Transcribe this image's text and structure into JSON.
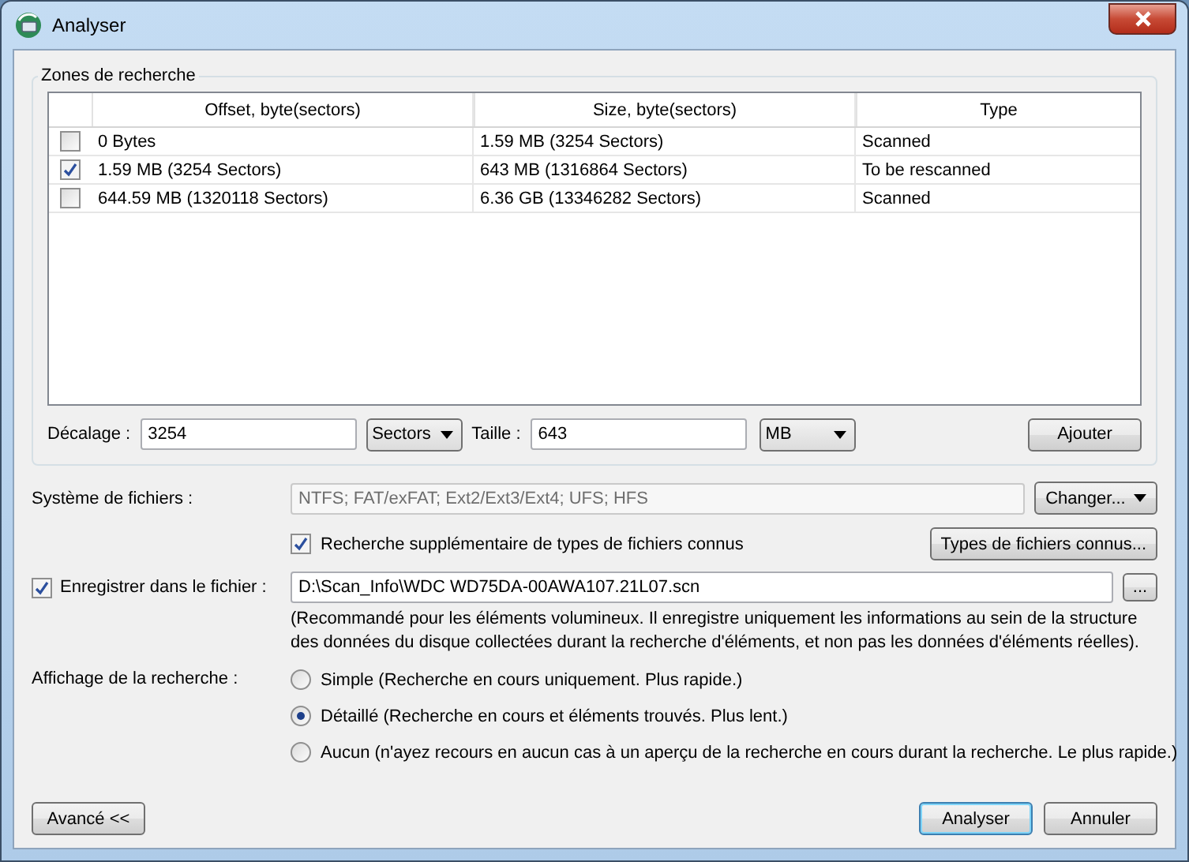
{
  "window": {
    "title": "Analyser"
  },
  "search_zones": {
    "title": "Zones de recherche",
    "columns": [
      "Offset, byte(sectors)",
      "Size, byte(sectors)",
      "Type"
    ],
    "rows": [
      {
        "checked": false,
        "offset": "0 Bytes",
        "size": "1.59 MB (3254 Sectors)",
        "type": "Scanned"
      },
      {
        "checked": true,
        "offset": "1.59 MB (3254 Sectors)",
        "size": "643 MB (1316864 Sectors)",
        "type": "To be rescanned"
      },
      {
        "checked": false,
        "offset": "644.59 MB (1320118 Sectors)",
        "size": "6.36 GB (13346282 Sectors)",
        "type": "Scanned"
      }
    ],
    "offset_field": {
      "label": "Décalage :",
      "value": "3254",
      "unit": "Sectors"
    },
    "size_field": {
      "label": "Taille :",
      "value": "643",
      "unit": "MB"
    },
    "add_button": "Ajouter"
  },
  "file_system": {
    "label": "Système de fichiers :",
    "value": "NTFS; FAT/exFAT; Ext2/Ext3/Ext4; UFS; HFS",
    "disabled": true,
    "button": "Changer..."
  },
  "extra_search": {
    "label": "Recherche supplémentaire de types de fichiers connus",
    "checked": true,
    "button": "Types de fichiers connus..."
  },
  "save_to_file": {
    "label": "Enregistrer dans le fichier :",
    "checked": true,
    "value": "D:\\Scan_Info\\WDC WD75DA-00AWA107.21L07.scn",
    "browse": "...",
    "note": "(Recommandé pour les éléments volumineux. Il enregistre uniquement les informations au sein de la structure des données du disque collectées durant la recherche d'éléments, et non pas les données d'éléments réelles)."
  },
  "display": {
    "label": "Affichage de la recherche :",
    "options": [
      {
        "label": "Simple (Recherche en cours uniquement. Plus rapide.)",
        "selected": false
      },
      {
        "label": "Détaillé (Recherche en cours et éléments trouvés. Plus lent.)",
        "selected": true
      },
      {
        "label": "Aucun (n'ayez recours en aucun cas à un aperçu de la recherche en cours durant la recherche. Le plus rapide.)",
        "selected": false
      }
    ]
  },
  "buttons": {
    "advanced": "Avancé <<",
    "analyze": "Analyser",
    "cancel": "Annuler"
  }
}
